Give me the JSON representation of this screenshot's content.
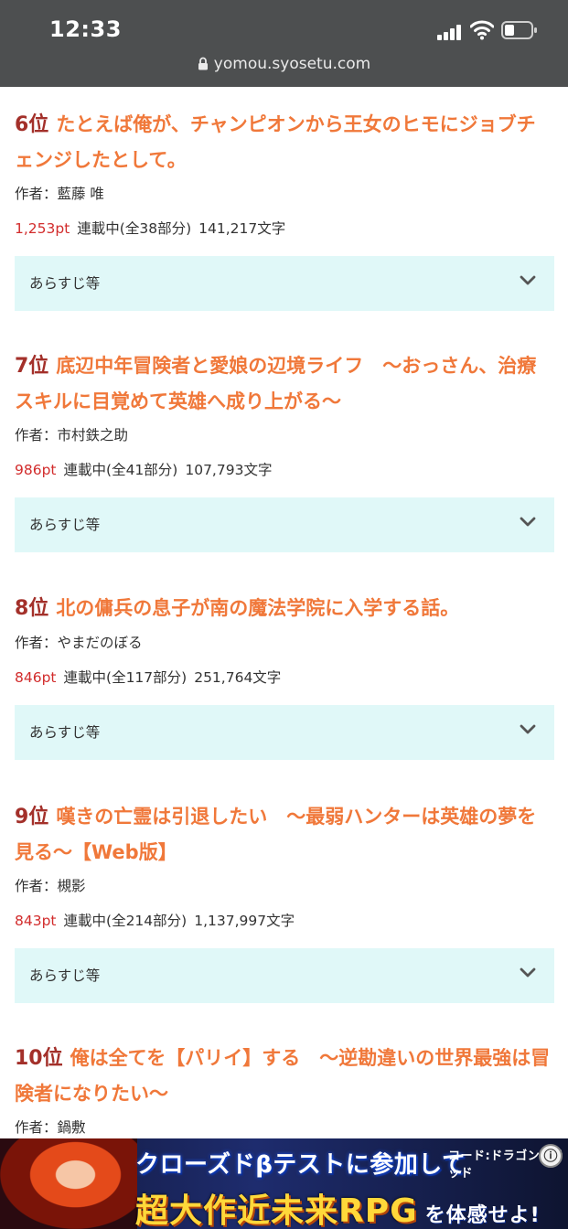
{
  "status_bar": {
    "time": "12:33",
    "url": "yomou.syosetu.com"
  },
  "entries": [
    {
      "rank": "6位",
      "title": "たとえば俺が、チャンピオンから王女のヒモにジョブチェンジしたとして。",
      "author": "作者：藍藤 唯",
      "points": "1,253pt",
      "serial": "連載中(全38部分)",
      "chars": "141,217文字",
      "summary_label": "あらすじ等"
    },
    {
      "rank": "7位",
      "title": "底辺中年冒険者と愛娘の辺境ライフ　〜おっさん、治療スキルに目覚めて英雄へ成り上がる〜",
      "author": "作者：市村鉄之助",
      "points": "986pt",
      "serial": "連載中(全41部分)",
      "chars": "107,793文字",
      "summary_label": "あらすじ等"
    },
    {
      "rank": "8位",
      "title": "北の傭兵の息子が南の魔法学院に入学する話。",
      "author": "作者：やまだのぼる",
      "points": "846pt",
      "serial": "連載中(全117部分)",
      "chars": "251,764文字",
      "summary_label": "あらすじ等"
    },
    {
      "rank": "9位",
      "title": "嘆きの亡霊は引退したい　〜最弱ハンターは英雄の夢を見る〜【Web版】",
      "author": "作者：槻影",
      "points": "843pt",
      "serial": "連載中(全214部分)",
      "chars": "1,137,997文字",
      "summary_label": "あらすじ等"
    },
    {
      "rank": "10位",
      "title": "俺は全てを【パリイ】する　〜逆勘違いの世界最強は冒険者になりたい〜",
      "author": "作者：鍋敷"
    }
  ],
  "ad": {
    "line1": "クローズドβテストに参加して",
    "line2": "超大作近未来RPG",
    "line2_tail": "を体感せよ!",
    "logo": "コード:ドラゴンブラッド",
    "info_icon": "ⓘ"
  },
  "colors": {
    "rank": "#a3302a",
    "title": "#f0783a",
    "points": "#d22c2c",
    "summary_bg": "#e0f8f8",
    "status_bg": "#4d4f50"
  }
}
